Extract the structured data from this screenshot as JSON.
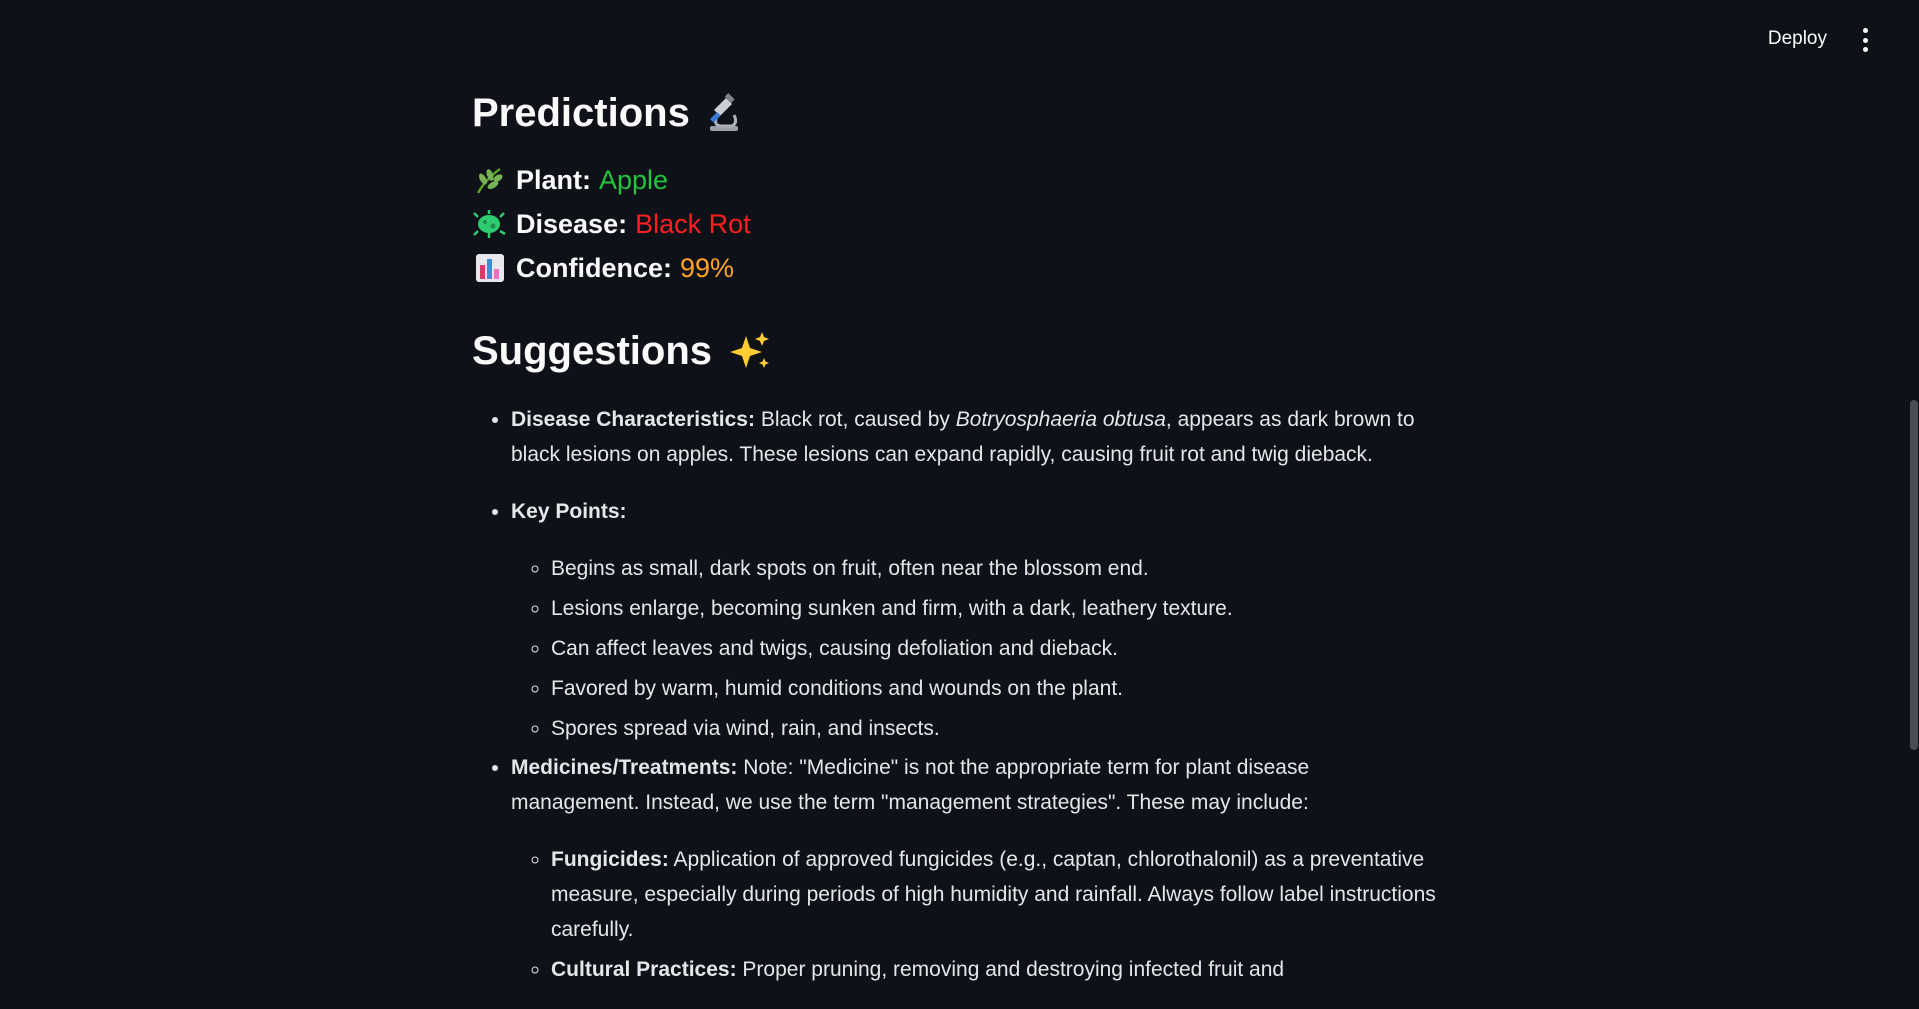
{
  "header": {
    "deploy_label": "Deploy",
    "menu_icon": "vertical-ellipsis-icon"
  },
  "predictions": {
    "title": "Predictions",
    "title_icon": "microscope-icon",
    "rows": [
      {
        "icon": "herb-icon",
        "label": "Plant:",
        "value": "Apple",
        "color": "#21c33f"
      },
      {
        "icon": "microbe-icon",
        "label": "Disease:",
        "value": "Black Rot",
        "color": "#ff1f1f"
      },
      {
        "icon": "bar-chart-icon",
        "label": "Confidence:",
        "value": "99%",
        "color": "#ffa421"
      }
    ]
  },
  "suggestions": {
    "title": "Suggestions",
    "title_icon": "sparkles-icon",
    "disease_characteristics": {
      "label": "Disease Characteristics:",
      "text_before": "Black rot, caused by",
      "italic": "Botryosphaeria obtusa",
      "text_after": ", appears as dark brown to black lesions on apples. These lesions can expand rapidly, causing fruit rot and twig dieback."
    },
    "key_points": {
      "label": "Key Points:",
      "items": [
        "Begins as small, dark spots on fruit, often near the blossom end.",
        "Lesions enlarge, becoming sunken and firm, with a dark, leathery texture.",
        "Can affect leaves and twigs, causing defoliation and dieback.",
        "Favored by warm, humid conditions and wounds on the plant.",
        "Spores spread via wind, rain, and insects."
      ]
    },
    "treatments": {
      "label": "Medicines/Treatments:",
      "text": "Note: \"Medicine\" is not the appropriate term for plant disease management. Instead, we use the term \"management strategies\". These may include:",
      "items": [
        {
          "label": "Fungicides:",
          "text": "Application of approved fungicides (e.g., captan, chlorothalonil) as a preventative measure, especially during periods of high humidity and rainfall. Always follow label instructions carefully."
        },
        {
          "label": "Cultural Practices:",
          "text": "Proper pruning, removing and destroying infected fruit and"
        }
      ]
    }
  }
}
